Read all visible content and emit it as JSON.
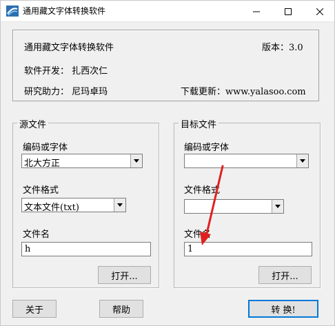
{
  "window": {
    "title": "通用藏文字体转换软件"
  },
  "info": {
    "app_name": "通用藏文字体转换软件",
    "version": "版本：3.0",
    "developer": "软件开发：  扎西次仁",
    "assistant": "研究助力：  尼玛卓玛",
    "download": "下载更新：www.yalasoo.com"
  },
  "source": {
    "legend": "源文件",
    "encoding_label": "编码或字体",
    "encoding_value": "北大方正",
    "format_label": "文件格式",
    "format_value": "文本文件(txt)",
    "filename_label": "文件名",
    "filename_value": "h",
    "open_button": "打开..."
  },
  "target": {
    "legend": "目标文件",
    "encoding_label": "编码或字体",
    "encoding_value": "",
    "format_label": "文件格式",
    "format_value": "",
    "filename_label": "文件名",
    "filename_value": "1",
    "open_button": "打开..."
  },
  "footer": {
    "about_button": "关于",
    "help_button": "帮助",
    "convert_button": "转 换!"
  },
  "colors": {
    "annotation_arrow": "#e02020",
    "default_button_border": "#0078d7"
  },
  "icons": {
    "app": "app-logo-icon",
    "minimize": "minimize-icon",
    "maximize": "maximize-icon",
    "close": "close-icon",
    "dropdown": "chevron-down-icon"
  }
}
